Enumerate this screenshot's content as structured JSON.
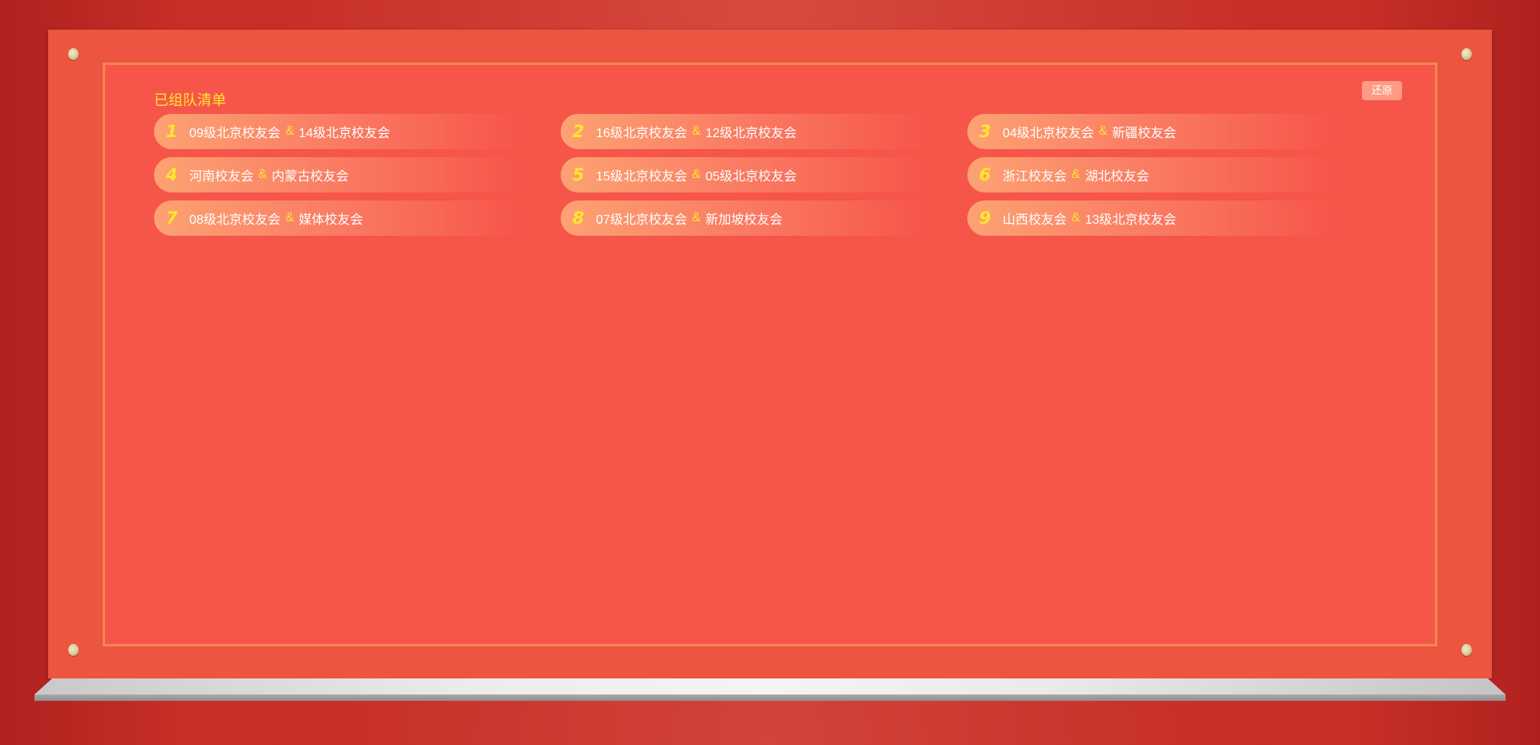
{
  "board": {
    "title": "已组队清单",
    "restore_label": "还原"
  },
  "teams": [
    {
      "num": "1",
      "a": "09级北京校友会",
      "sep": "&",
      "b": "14级北京校友会"
    },
    {
      "num": "2",
      "a": "16级北京校友会",
      "sep": "&",
      "b": "12级北京校友会"
    },
    {
      "num": "3",
      "a": "04级北京校友会",
      "sep": "&",
      "b": "新疆校友会"
    },
    {
      "num": "4",
      "a": "河南校友会",
      "sep": "&",
      "b": "内蒙古校友会"
    },
    {
      "num": "5",
      "a": "15级北京校友会",
      "sep": "&",
      "b": "05级北京校友会"
    },
    {
      "num": "6",
      "a": "浙江校友会",
      "sep": "&",
      "b": "湖北校友会"
    },
    {
      "num": "7",
      "a": "08级北京校友会",
      "sep": "&",
      "b": "媒体校友会"
    },
    {
      "num": "8",
      "a": "07级北京校友会",
      "sep": "&",
      "b": "新加坡校友会"
    },
    {
      "num": "9",
      "a": "山西校友会",
      "sep": "&",
      "b": "13级北京校友会"
    }
  ],
  "colors": {
    "accent": "#ffe62b",
    "board": "#ec553f",
    "panel": "#f6554a",
    "border": "#f6874f"
  }
}
